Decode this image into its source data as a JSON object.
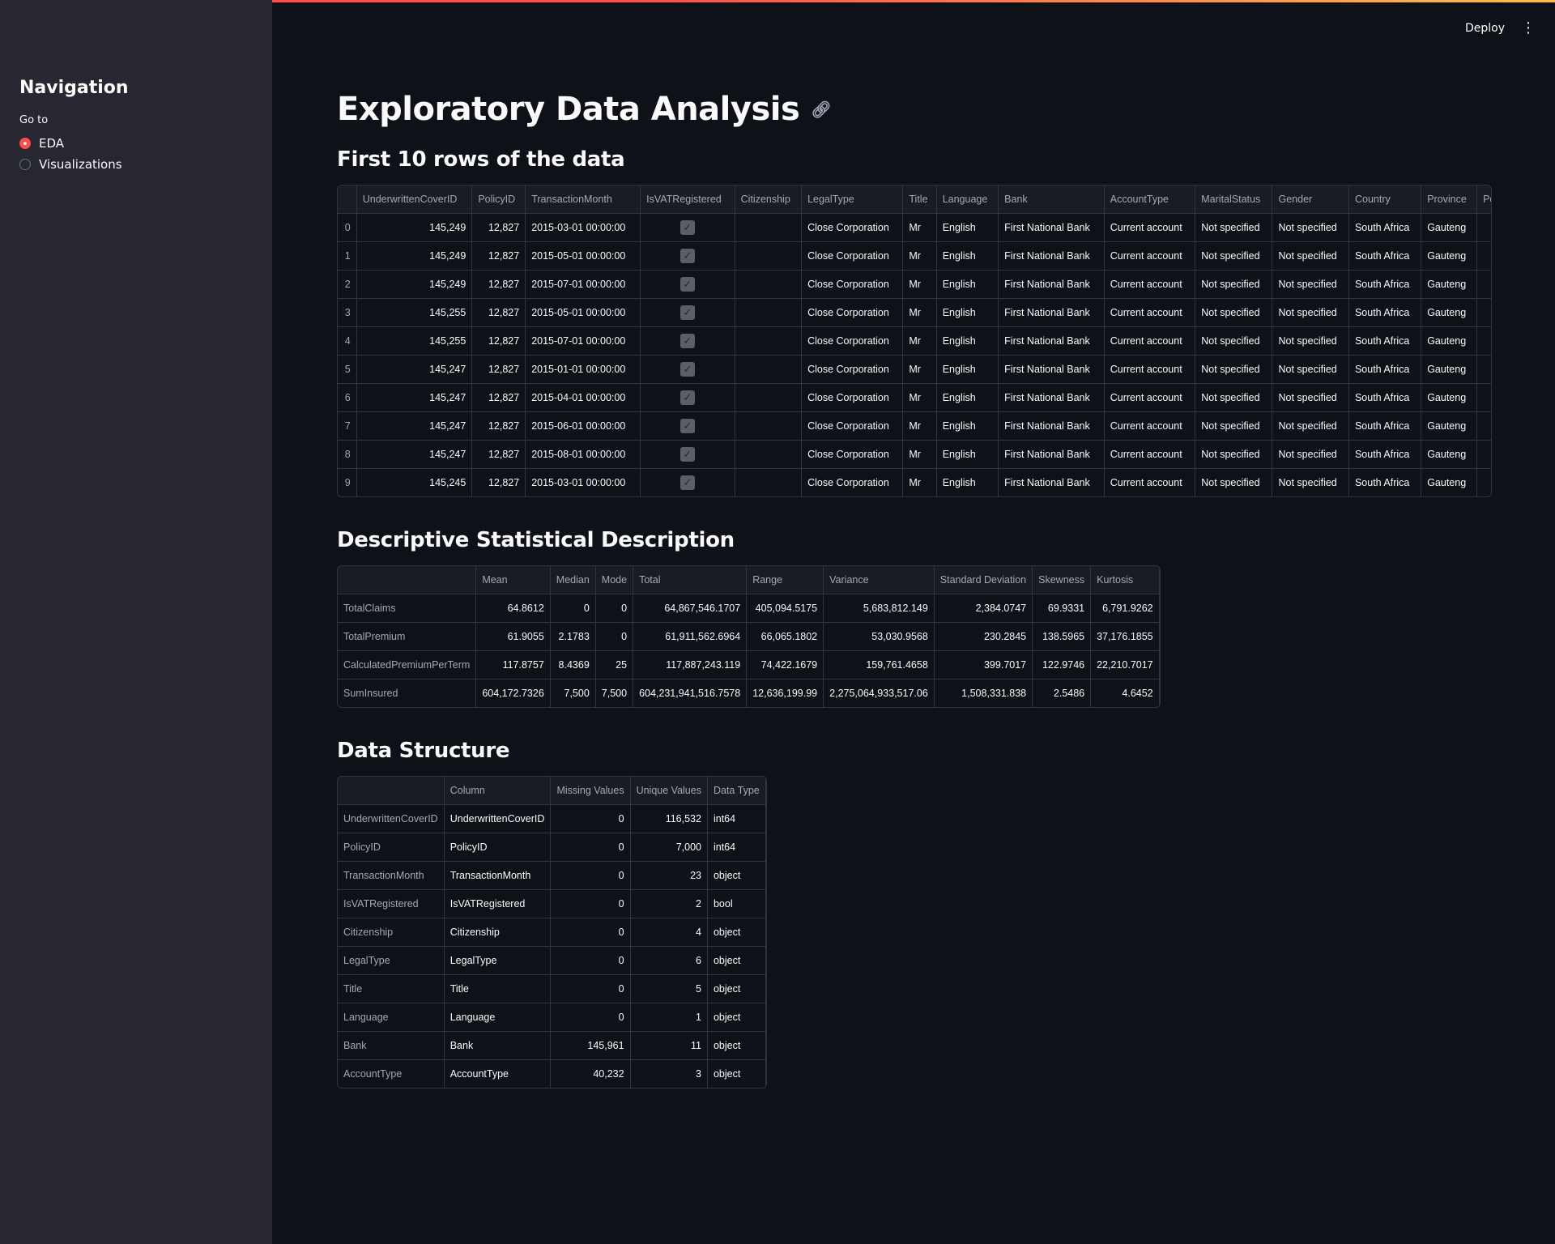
{
  "header": {
    "deploy_label": "Deploy",
    "menu_icon": "kebab-menu-icon"
  },
  "sidebar": {
    "title": "Navigation",
    "goto_label": "Go to",
    "options": [
      {
        "label": "EDA",
        "selected": true
      },
      {
        "label": "Visualizations",
        "selected": false
      }
    ]
  },
  "main": {
    "title": "Exploratory Data Analysis",
    "link_icon": "link-icon",
    "first_rows": {
      "heading": "First 10 rows of the data",
      "columns": [
        "",
        "UnderwrittenCoverID",
        "PolicyID",
        "TransactionMonth",
        "IsVATRegistered",
        "Citizenship",
        "LegalType",
        "Title",
        "Language",
        "Bank",
        "AccountType",
        "MaritalStatus",
        "Gender",
        "Country",
        "Province",
        "Po"
      ],
      "rows": [
        [
          "0",
          "145,249",
          "12,827",
          "2015-03-01 00:00:00",
          true,
          "",
          "Close Corporation",
          "Mr",
          "English",
          "First National Bank",
          "Current account",
          "Not specified",
          "Not specified",
          "South Africa",
          "Gauteng",
          ""
        ],
        [
          "1",
          "145,249",
          "12,827",
          "2015-05-01 00:00:00",
          true,
          "",
          "Close Corporation",
          "Mr",
          "English",
          "First National Bank",
          "Current account",
          "Not specified",
          "Not specified",
          "South Africa",
          "Gauteng",
          ""
        ],
        [
          "2",
          "145,249",
          "12,827",
          "2015-07-01 00:00:00",
          true,
          "",
          "Close Corporation",
          "Mr",
          "English",
          "First National Bank",
          "Current account",
          "Not specified",
          "Not specified",
          "South Africa",
          "Gauteng",
          ""
        ],
        [
          "3",
          "145,255",
          "12,827",
          "2015-05-01 00:00:00",
          true,
          "",
          "Close Corporation",
          "Mr",
          "English",
          "First National Bank",
          "Current account",
          "Not specified",
          "Not specified",
          "South Africa",
          "Gauteng",
          ""
        ],
        [
          "4",
          "145,255",
          "12,827",
          "2015-07-01 00:00:00",
          true,
          "",
          "Close Corporation",
          "Mr",
          "English",
          "First National Bank",
          "Current account",
          "Not specified",
          "Not specified",
          "South Africa",
          "Gauteng",
          ""
        ],
        [
          "5",
          "145,247",
          "12,827",
          "2015-01-01 00:00:00",
          true,
          "",
          "Close Corporation",
          "Mr",
          "English",
          "First National Bank",
          "Current account",
          "Not specified",
          "Not specified",
          "South Africa",
          "Gauteng",
          ""
        ],
        [
          "6",
          "145,247",
          "12,827",
          "2015-04-01 00:00:00",
          true,
          "",
          "Close Corporation",
          "Mr",
          "English",
          "First National Bank",
          "Current account",
          "Not specified",
          "Not specified",
          "South Africa",
          "Gauteng",
          ""
        ],
        [
          "7",
          "145,247",
          "12,827",
          "2015-06-01 00:00:00",
          true,
          "",
          "Close Corporation",
          "Mr",
          "English",
          "First National Bank",
          "Current account",
          "Not specified",
          "Not specified",
          "South Africa",
          "Gauteng",
          ""
        ],
        [
          "8",
          "145,247",
          "12,827",
          "2015-08-01 00:00:00",
          true,
          "",
          "Close Corporation",
          "Mr",
          "English",
          "First National Bank",
          "Current account",
          "Not specified",
          "Not specified",
          "South Africa",
          "Gauteng",
          ""
        ],
        [
          "9",
          "145,245",
          "12,827",
          "2015-03-01 00:00:00",
          true,
          "",
          "Close Corporation",
          "Mr",
          "English",
          "First National Bank",
          "Current account",
          "Not specified",
          "Not specified",
          "South Africa",
          "Gauteng",
          ""
        ]
      ]
    },
    "stats": {
      "heading": "Descriptive Statistical Description",
      "columns": [
        "",
        "Mean",
        "Median",
        "Mode",
        "Total",
        "Range",
        "Variance",
        "Standard Deviation",
        "Skewness",
        "Kurtosis"
      ],
      "rows": [
        [
          "TotalClaims",
          "64.8612",
          "0",
          "0",
          "64,867,546.1707",
          "405,094.5175",
          "5,683,812.149",
          "2,384.0747",
          "69.9331",
          "6,791.9262"
        ],
        [
          "TotalPremium",
          "61.9055",
          "2.1783",
          "0",
          "61,911,562.6964",
          "66,065.1802",
          "53,030.9568",
          "230.2845",
          "138.5965",
          "37,176.1855"
        ],
        [
          "CalculatedPremiumPerTerm",
          "117.8757",
          "8.4369",
          "25",
          "117,887,243.119",
          "74,422.1679",
          "159,761.4658",
          "399.7017",
          "122.9746",
          "22,210.7017"
        ],
        [
          "SumInsured",
          "604,172.7326",
          "7,500",
          "7,500",
          "604,231,941,516.7578",
          "12,636,199.99",
          "2,275,064,933,517.06",
          "1,508,331.838",
          "2.5486",
          "4.6452"
        ]
      ]
    },
    "structure": {
      "heading": "Data Structure",
      "columns": [
        "",
        "Column",
        "Missing Values",
        "Unique Values",
        "Data Type"
      ],
      "rows": [
        [
          "UnderwrittenCoverID",
          "UnderwrittenCoverID",
          "0",
          "116,532",
          "int64"
        ],
        [
          "PolicyID",
          "PolicyID",
          "0",
          "7,000",
          "int64"
        ],
        [
          "TransactionMonth",
          "TransactionMonth",
          "0",
          "23",
          "object"
        ],
        [
          "IsVATRegistered",
          "IsVATRegistered",
          "0",
          "2",
          "bool"
        ],
        [
          "Citizenship",
          "Citizenship",
          "0",
          "4",
          "object"
        ],
        [
          "LegalType",
          "LegalType",
          "0",
          "6",
          "object"
        ],
        [
          "Title",
          "Title",
          "0",
          "5",
          "object"
        ],
        [
          "Language",
          "Language",
          "0",
          "1",
          "object"
        ],
        [
          "Bank",
          "Bank",
          "145,961",
          "11",
          "object"
        ],
        [
          "AccountType",
          "AccountType",
          "40,232",
          "3",
          "object"
        ]
      ]
    }
  },
  "colors": {
    "accent": "#ff4b4b",
    "background": "#0e1117",
    "sidebar": "#262730"
  }
}
